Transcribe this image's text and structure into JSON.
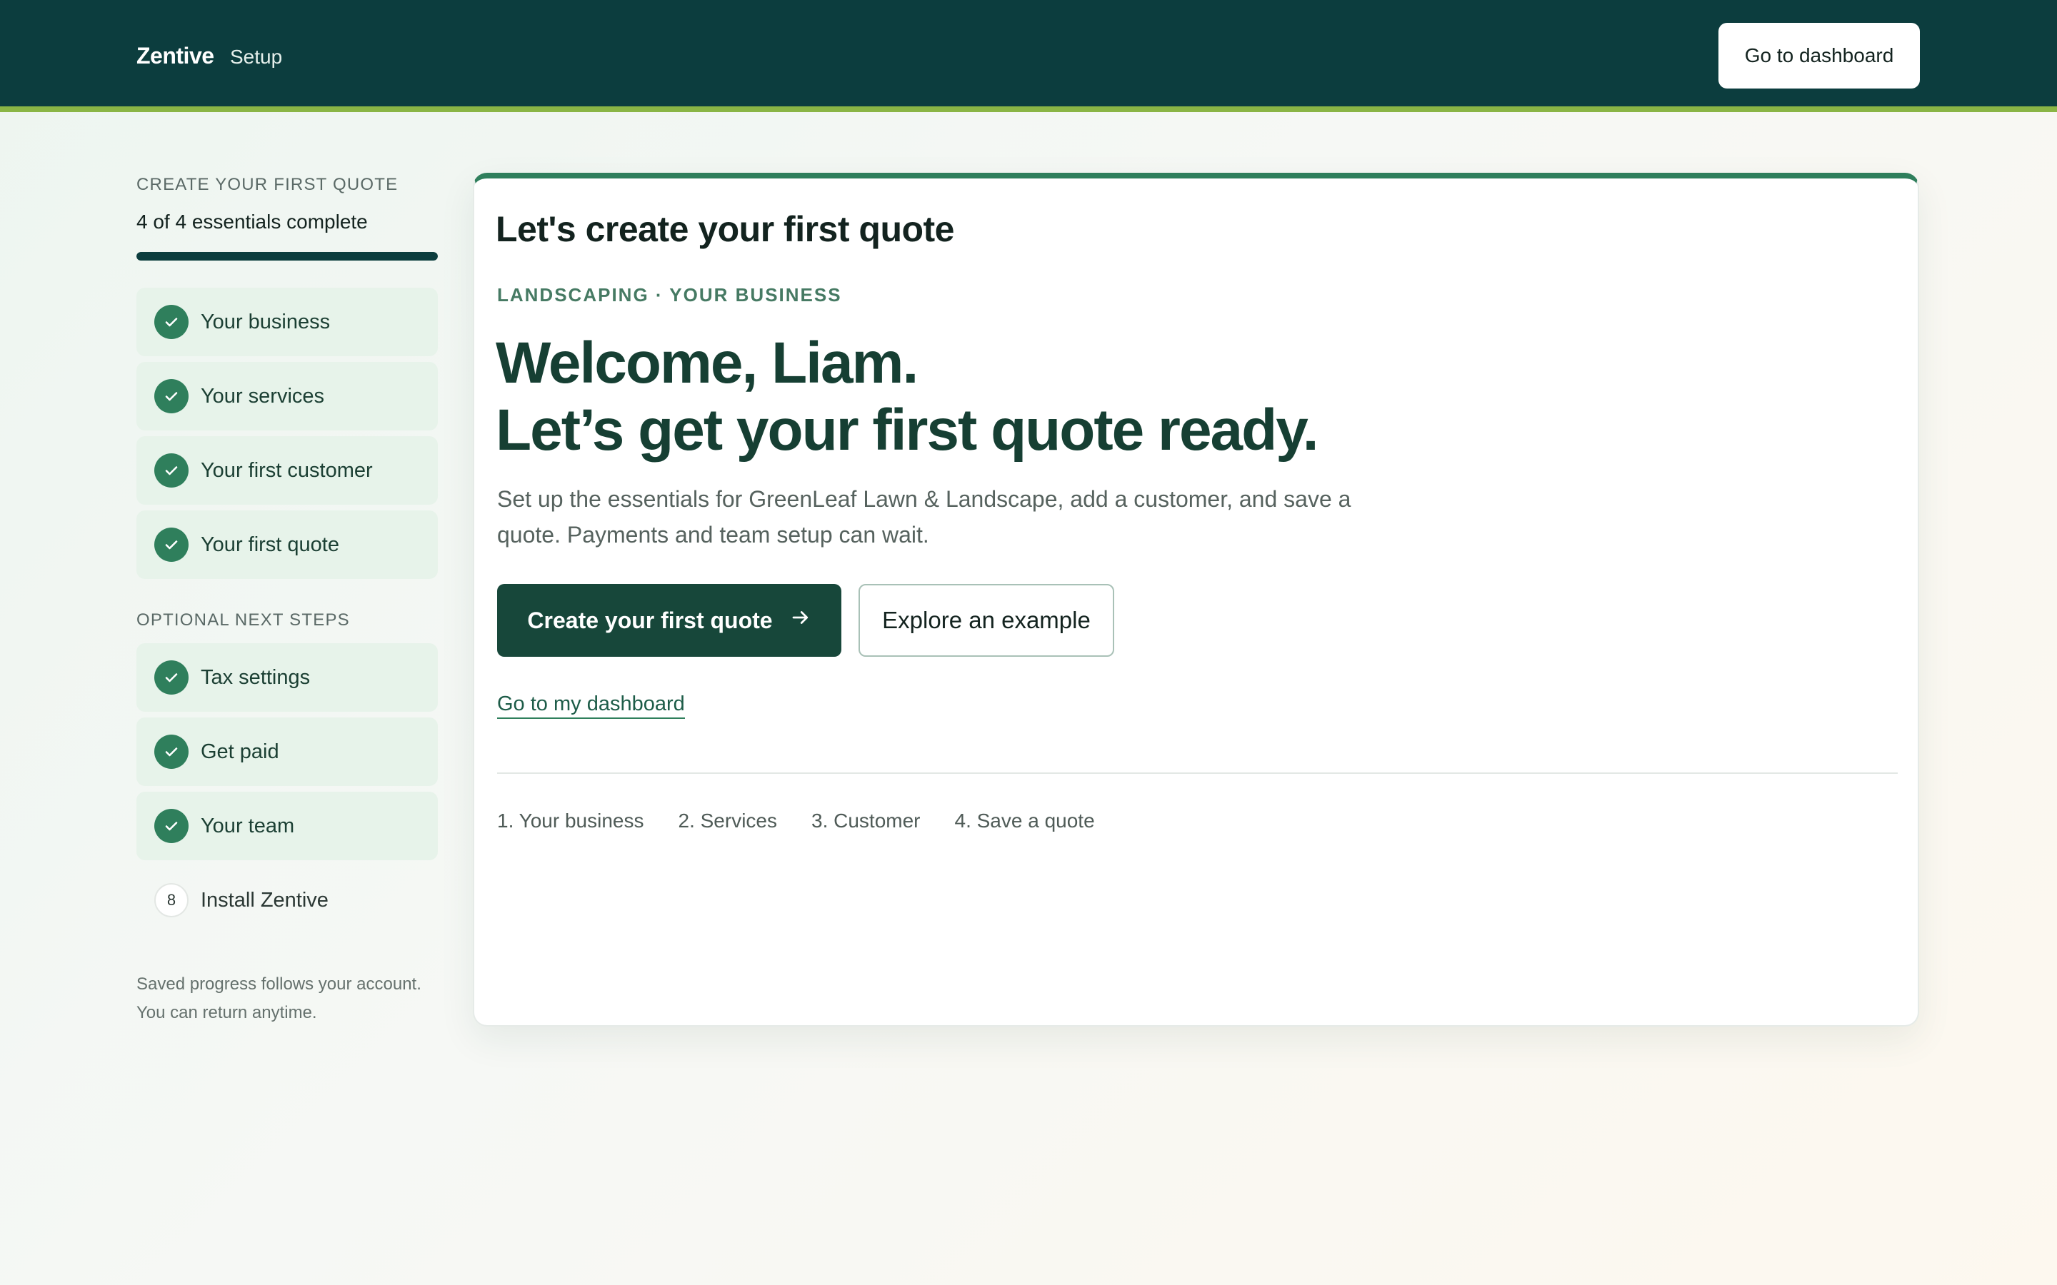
{
  "header": {
    "brand": "Zentive",
    "section": "Setup",
    "dashboard_button": "Go to dashboard"
  },
  "sidebar": {
    "heading": "CREATE YOUR FIRST QUOTE",
    "progress_text": "4 of 4 essentials complete",
    "progress_fraction": 1.0,
    "essentials": [
      {
        "label": "Your business",
        "status": "complete"
      },
      {
        "label": "Your services",
        "status": "complete"
      },
      {
        "label": "Your first customer",
        "status": "complete"
      },
      {
        "label": "Your first quote",
        "status": "complete"
      }
    ],
    "optional_heading": "OPTIONAL NEXT STEPS",
    "optional": [
      {
        "label": "Tax settings",
        "status": "complete"
      },
      {
        "label": "Get paid",
        "status": "complete"
      },
      {
        "label": "Your team",
        "status": "complete"
      },
      {
        "label": "Install Zentive",
        "status": "pending",
        "number": "8"
      }
    ],
    "note_line1": "Saved progress follows your account.",
    "note_line2": "You can return anytime."
  },
  "main": {
    "title": "Let's create your first quote",
    "eyebrow": "LANDSCAPING · YOUR BUSINESS",
    "headline_line1": "Welcome, Liam.",
    "headline_line2": "Let’s get your first quote ready.",
    "description": "Set up the essentials for GreenLeaf Lawn & Landscape, add a customer, and save a quote. Payments and team setup can wait.",
    "primary_button": "Create your first quote",
    "secondary_button": "Explore an example",
    "dashboard_link": "Go to my dashboard",
    "mini_steps": [
      "1. Your business",
      "2. Services",
      "3. Customer",
      "4. Save a quote"
    ]
  },
  "colors": {
    "topbar": "#0c3d3e",
    "accent_stripe": "#8ab545",
    "check_green": "#2f7f5c",
    "primary_button": "#17473a"
  }
}
